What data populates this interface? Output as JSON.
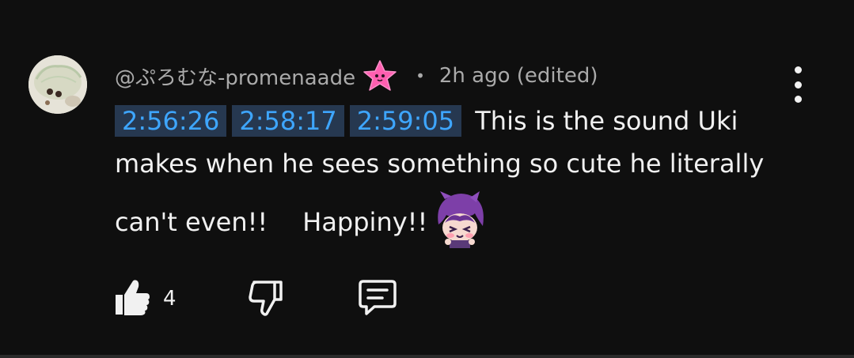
{
  "comment": {
    "author_handle": "@ぷろむな-promenaade",
    "badge_icon": "pink-star-icon",
    "separator": "•",
    "timestamp": "2h ago (edited)",
    "timestamps": [
      "2:56:26",
      "2:58:17",
      "2:59:05"
    ],
    "line1_text": "This is the sound Uki",
    "line2_text": "makes when he sees something so cute he literally",
    "line3_text_a": "can't even!!",
    "line3_text_b": "Happiny!!",
    "custom_emoji_icon": "purple-hair-chibi-emoji",
    "like_count": "4"
  },
  "actions": {
    "like_icon": "thumbs-up-icon",
    "dislike_icon": "thumbs-down-icon",
    "reply_icon": "comment-reply-icon",
    "more_icon": "kebab-menu-icon"
  },
  "colors": {
    "background": "#0f0f0f",
    "text": "#f1f1f1",
    "secondary_text": "#aaaaaa",
    "timestamp_link": "#3ea6ff",
    "timestamp_bg": "#263850",
    "badge_pink": "#ff5fb0"
  }
}
